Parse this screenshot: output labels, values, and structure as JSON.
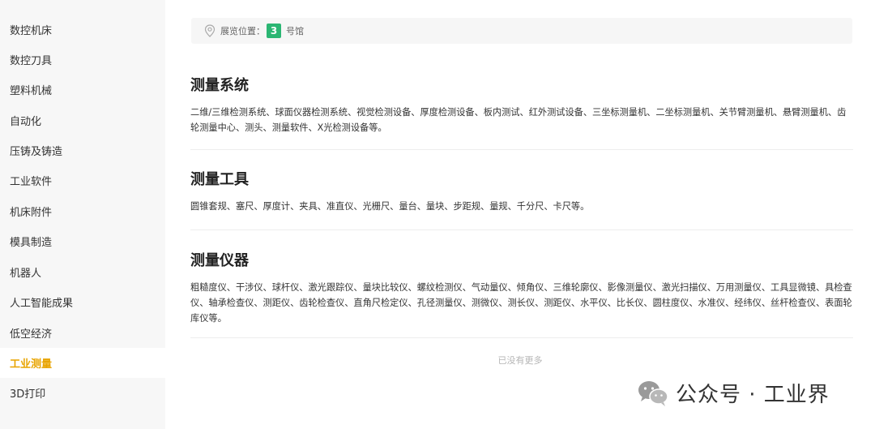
{
  "sidebar": {
    "items": [
      {
        "label": "数控机床"
      },
      {
        "label": "数控刀具"
      },
      {
        "label": "塑料机械"
      },
      {
        "label": "自动化"
      },
      {
        "label": "压铸及铸造"
      },
      {
        "label": "工业软件"
      },
      {
        "label": "机床附件"
      },
      {
        "label": "模具制造"
      },
      {
        "label": "机器人"
      },
      {
        "label": "人工智能成果"
      },
      {
        "label": "低空经济"
      },
      {
        "label": "工业测量"
      },
      {
        "label": "3D打印"
      }
    ],
    "active_index": 11,
    "active_color": "#e8a400"
  },
  "location": {
    "label": "展览位置：",
    "hall_number": "3",
    "hall_suffix": "号馆",
    "badge_color": "#2bb673",
    "icon": "location-pin-icon"
  },
  "sections": [
    {
      "title": "测量系统",
      "text": "二维/三维检测系统、球面仪器检测系统、视觉检测设备、厚度检测设备、板内测试、红外测试设备、三坐标测量机、二坐标测量机、关节臂测量机、悬臂测量机、齿轮测量中心、测头、测量软件、X光检测设备等。"
    },
    {
      "title": "测量工具",
      "text": "圆锥套规、塞尺、厚度计、夹具、准直仪、光栅尺、量台、量块、步距规、量规、千分尺、卡尺等。"
    },
    {
      "title": "测量仪器",
      "text": "粗糙度仪、干涉仪、球杆仪、激光跟踪仪、量块比较仪、螺纹检测仪、气动量仪、倾角仪、三维轮廓仪、影像测量仪、激光扫描仪、万用测量仪、工具显微镜、具检查仪、轴承检查仪、测距仪、齿轮检查仪、直角尺检定仪、孔径测量仪、测微仪、测长仪、测距仪、水平仪、比长仪、圆柱度仪、水准仪、经纬仪、丝杆检查仪、表面轮库仪等。"
    }
  ],
  "footer": {
    "no_more": "已没有更多"
  },
  "watermark": {
    "text": "公众号 · 工业界",
    "icon": "wechat-icon"
  }
}
